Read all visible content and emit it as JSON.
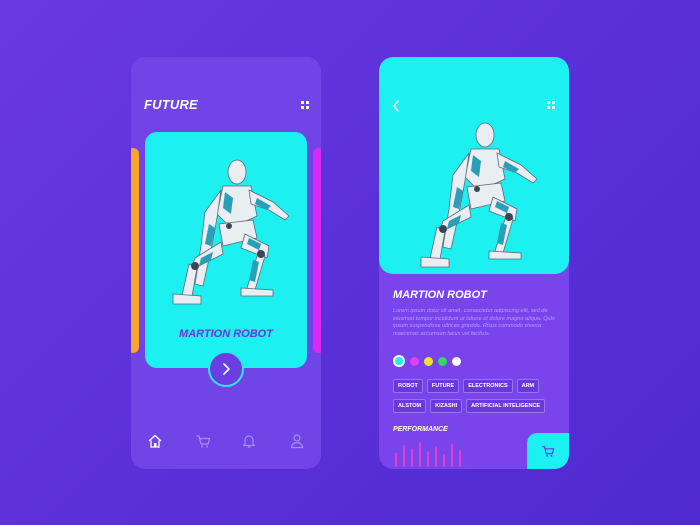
{
  "left_screen": {
    "title": "FUTURE",
    "card": {
      "name": "MARTION ROBOT"
    },
    "nav": [
      "home-icon",
      "cart-icon",
      "bell-icon",
      "user-icon"
    ]
  },
  "right_screen": {
    "product_name": "MARTION ROBOT",
    "description": "Lorem ipsum dolor sit amet, consectetur adipiscing elit, sed do eiusmod tempor incididunt ut labore et dolore magna aliqua. Quis ipsum suspendisse ultrices gravida. Risus commodo viverra maecenas accumsan lacus vel facilisis.",
    "colors": [
      "#1cf0f0",
      "#e040f0",
      "#f2e229",
      "#32d860",
      "#ffffff"
    ],
    "selected_color_index": 0,
    "tags": [
      "ROBOT",
      "FUTURE",
      "ELECTRONICS",
      "ARM",
      "ALSTOM",
      "KIZASHI",
      "ARTIFICIAL INTELIGENCE"
    ],
    "performance_label": "PERFORMANCE",
    "performance_bars": [
      0.55,
      0.85,
      0.7,
      0.95,
      0.6,
      0.8,
      0.5,
      0.9,
      0.65
    ]
  },
  "theme": {
    "background": "#5a2fd8",
    "cyan": "#1cf0f0",
    "accent_orange": "#f7a62a",
    "accent_magenta": "#d62bf0",
    "bar_color": "#e040d0"
  }
}
